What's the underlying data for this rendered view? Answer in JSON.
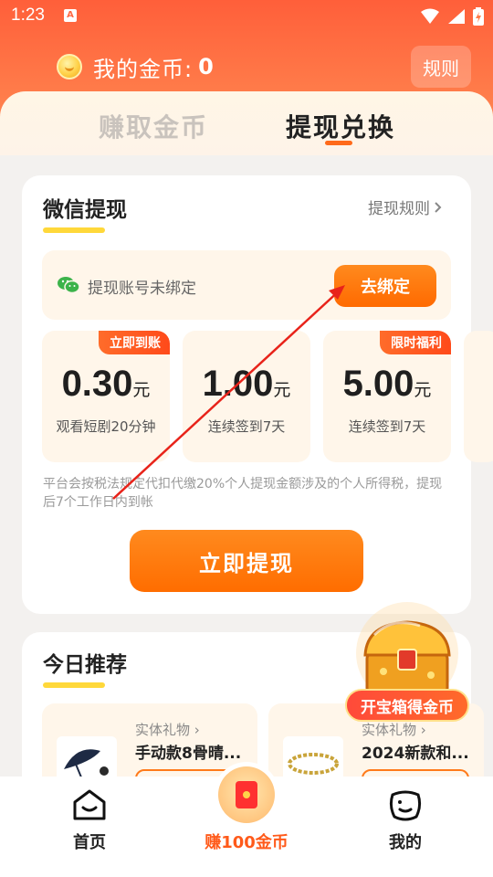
{
  "status_bar": {
    "time": "1:23",
    "app_badge": "A"
  },
  "header": {
    "coin_label": "我的金币:",
    "coin_value": "0",
    "rules_button": "规则"
  },
  "tabs": [
    {
      "label": "赚取金币",
      "active": false
    },
    {
      "label": "提现兑换",
      "active": true
    }
  ],
  "withdraw_card": {
    "title": "微信提现",
    "rules_link": "提现规则",
    "account_status": "提现账号未绑定",
    "bind_button": "去绑定",
    "amounts": [
      {
        "value": "0.30",
        "unit": "元",
        "desc": "观看短剧20分钟",
        "tag": "立即到账"
      },
      {
        "value": "1.00",
        "unit": "元",
        "desc": "连续签到7天",
        "tag": ""
      },
      {
        "value": "5.00",
        "unit": "元",
        "desc": "连续签到7天",
        "tag": "限时福利"
      }
    ],
    "tax_note": "平台会按税法规定代扣代缴20%个人提现金额涉及的个人所得税，提现后7个工作日内到帐",
    "withdraw_button": "立即提现"
  },
  "recommend": {
    "title": "今日推荐",
    "products": [
      {
        "category": "实体礼物",
        "name": "手动款8骨晴..."
      },
      {
        "category": "实体礼物",
        "name": "2024新款和..."
      }
    ]
  },
  "treasure": {
    "label": "开宝箱得金币"
  },
  "bottom_nav": {
    "home": "首页",
    "earn": "赚100金币",
    "mine": "我的"
  },
  "colors": {
    "accent": "#ff6a00",
    "header": "#ff6b45",
    "highlight": "#ffd83a"
  }
}
